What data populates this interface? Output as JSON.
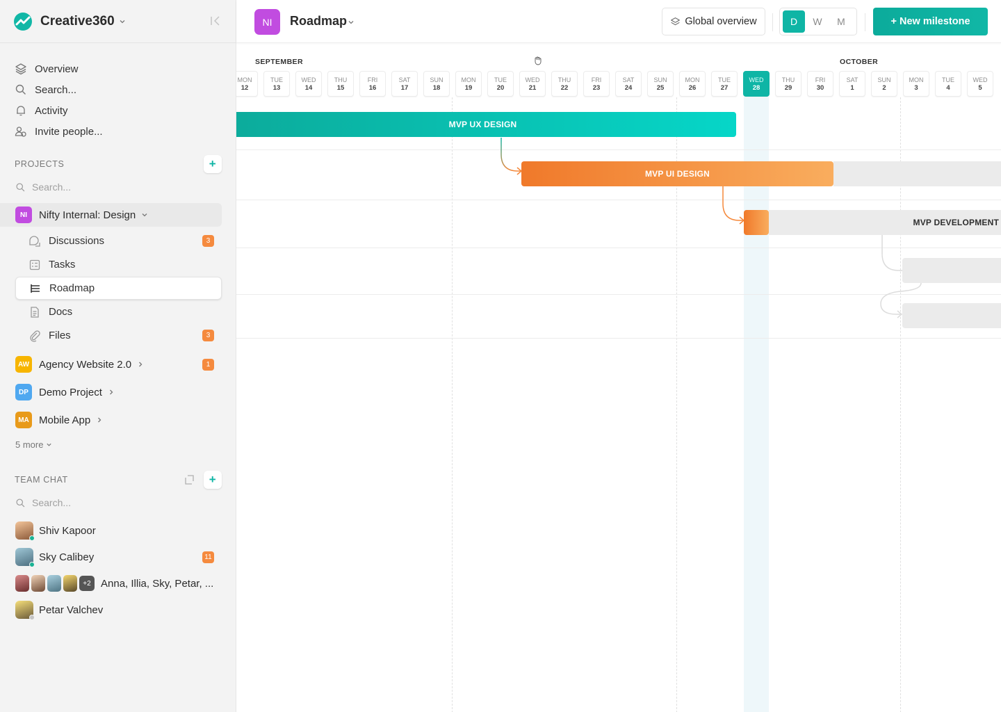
{
  "app": {
    "name": "Creative360"
  },
  "nav": {
    "overview": "Overview",
    "search": "Search...",
    "activity": "Activity",
    "invite": "Invite people..."
  },
  "projects": {
    "heading": "PROJECTS",
    "search_placeholder": "Search...",
    "active": {
      "badge": "NI",
      "name": "Nifty Internal: Design",
      "color": "#c14ce0"
    },
    "sub_items": [
      {
        "label": "Discussions",
        "count": "3"
      },
      {
        "label": "Tasks"
      },
      {
        "label": "Roadmap"
      },
      {
        "label": "Docs"
      },
      {
        "label": "Files",
        "count": "3"
      }
    ],
    "others": [
      {
        "badge": "AW",
        "name": "Agency Website 2.0",
        "color": "#f7b500",
        "count": "1"
      },
      {
        "badge": "DP",
        "name": "Demo Project",
        "color": "#4fa8f0"
      },
      {
        "badge": "MA",
        "name": "Mobile App",
        "color": "#e89a1a"
      }
    ],
    "more": "5 more"
  },
  "team_chat": {
    "heading": "TEAM CHAT",
    "search_placeholder": "Search...",
    "chats": [
      {
        "name": "Shiv Kapoor",
        "status": "online"
      },
      {
        "name": "Sky Calibey",
        "status": "online",
        "count": "11"
      },
      {
        "name": "Anna, Illia, Sky, Petar, ...",
        "extra": "+2"
      },
      {
        "name": "Petar Valchev",
        "status": "offline"
      }
    ]
  },
  "header": {
    "badge": "NI",
    "title": "Roadmap",
    "global_overview": "Global overview",
    "view_modes": [
      "D",
      "W",
      "M"
    ],
    "active_view": "D",
    "new_milestone": "+ New milestone"
  },
  "timeline": {
    "months": [
      {
        "label": "SEPTEMBER"
      },
      {
        "label": "OCTOBER"
      }
    ],
    "days": [
      {
        "dow": "MON",
        "num": "12"
      },
      {
        "dow": "TUE",
        "num": "13"
      },
      {
        "dow": "WED",
        "num": "14"
      },
      {
        "dow": "THU",
        "num": "15"
      },
      {
        "dow": "FRI",
        "num": "16"
      },
      {
        "dow": "SAT",
        "num": "17"
      },
      {
        "dow": "SUN",
        "num": "18"
      },
      {
        "dow": "MON",
        "num": "19"
      },
      {
        "dow": "TUE",
        "num": "20"
      },
      {
        "dow": "WED",
        "num": "21"
      },
      {
        "dow": "THU",
        "num": "22"
      },
      {
        "dow": "FRI",
        "num": "23"
      },
      {
        "dow": "SAT",
        "num": "24"
      },
      {
        "dow": "SUN",
        "num": "25"
      },
      {
        "dow": "MON",
        "num": "26"
      },
      {
        "dow": "TUE",
        "num": "27"
      },
      {
        "dow": "WED",
        "num": "28"
      },
      {
        "dow": "THU",
        "num": "29"
      },
      {
        "dow": "FRI",
        "num": "30"
      },
      {
        "dow": "SAT",
        "num": "1"
      },
      {
        "dow": "SUN",
        "num": "2"
      },
      {
        "dow": "MON",
        "num": "3"
      },
      {
        "dow": "TUE",
        "num": "4"
      },
      {
        "dow": "WED",
        "num": "5"
      }
    ],
    "today": "WED 28",
    "milestones": [
      {
        "name": "MVP UX DESIGN",
        "color": "#0fb5a5"
      },
      {
        "name": "MVP UI DESIGN",
        "color": "#f5883a"
      },
      {
        "name": "MVP DEVELOPMENT",
        "color": "#e9e9e9"
      }
    ]
  }
}
